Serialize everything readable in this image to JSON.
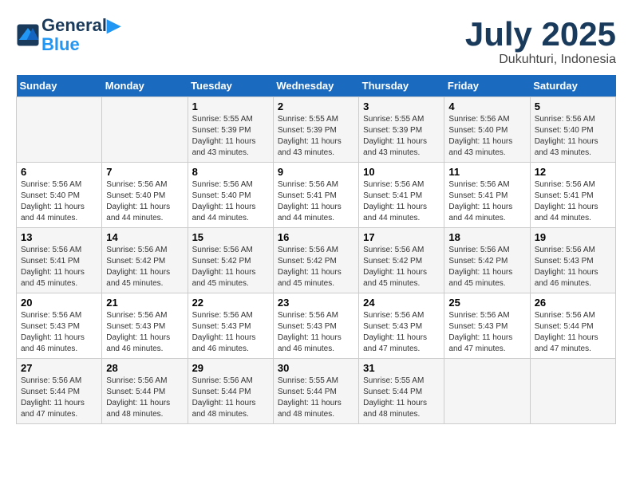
{
  "logo": {
    "line1": "General",
    "line2": "Blue"
  },
  "title": "July 2025",
  "subtitle": "Dukuhturi, Indonesia",
  "days_header": [
    "Sunday",
    "Monday",
    "Tuesday",
    "Wednesday",
    "Thursday",
    "Friday",
    "Saturday"
  ],
  "weeks": [
    [
      {
        "day": "",
        "info": ""
      },
      {
        "day": "",
        "info": ""
      },
      {
        "day": "1",
        "info": "Sunrise: 5:55 AM\nSunset: 5:39 PM\nDaylight: 11 hours and 43 minutes."
      },
      {
        "day": "2",
        "info": "Sunrise: 5:55 AM\nSunset: 5:39 PM\nDaylight: 11 hours and 43 minutes."
      },
      {
        "day": "3",
        "info": "Sunrise: 5:55 AM\nSunset: 5:39 PM\nDaylight: 11 hours and 43 minutes."
      },
      {
        "day": "4",
        "info": "Sunrise: 5:56 AM\nSunset: 5:40 PM\nDaylight: 11 hours and 43 minutes."
      },
      {
        "day": "5",
        "info": "Sunrise: 5:56 AM\nSunset: 5:40 PM\nDaylight: 11 hours and 43 minutes."
      }
    ],
    [
      {
        "day": "6",
        "info": "Sunrise: 5:56 AM\nSunset: 5:40 PM\nDaylight: 11 hours and 44 minutes."
      },
      {
        "day": "7",
        "info": "Sunrise: 5:56 AM\nSunset: 5:40 PM\nDaylight: 11 hours and 44 minutes."
      },
      {
        "day": "8",
        "info": "Sunrise: 5:56 AM\nSunset: 5:40 PM\nDaylight: 11 hours and 44 minutes."
      },
      {
        "day": "9",
        "info": "Sunrise: 5:56 AM\nSunset: 5:41 PM\nDaylight: 11 hours and 44 minutes."
      },
      {
        "day": "10",
        "info": "Sunrise: 5:56 AM\nSunset: 5:41 PM\nDaylight: 11 hours and 44 minutes."
      },
      {
        "day": "11",
        "info": "Sunrise: 5:56 AM\nSunset: 5:41 PM\nDaylight: 11 hours and 44 minutes."
      },
      {
        "day": "12",
        "info": "Sunrise: 5:56 AM\nSunset: 5:41 PM\nDaylight: 11 hours and 44 minutes."
      }
    ],
    [
      {
        "day": "13",
        "info": "Sunrise: 5:56 AM\nSunset: 5:41 PM\nDaylight: 11 hours and 45 minutes."
      },
      {
        "day": "14",
        "info": "Sunrise: 5:56 AM\nSunset: 5:42 PM\nDaylight: 11 hours and 45 minutes."
      },
      {
        "day": "15",
        "info": "Sunrise: 5:56 AM\nSunset: 5:42 PM\nDaylight: 11 hours and 45 minutes."
      },
      {
        "day": "16",
        "info": "Sunrise: 5:56 AM\nSunset: 5:42 PM\nDaylight: 11 hours and 45 minutes."
      },
      {
        "day": "17",
        "info": "Sunrise: 5:56 AM\nSunset: 5:42 PM\nDaylight: 11 hours and 45 minutes."
      },
      {
        "day": "18",
        "info": "Sunrise: 5:56 AM\nSunset: 5:42 PM\nDaylight: 11 hours and 45 minutes."
      },
      {
        "day": "19",
        "info": "Sunrise: 5:56 AM\nSunset: 5:43 PM\nDaylight: 11 hours and 46 minutes."
      }
    ],
    [
      {
        "day": "20",
        "info": "Sunrise: 5:56 AM\nSunset: 5:43 PM\nDaylight: 11 hours and 46 minutes."
      },
      {
        "day": "21",
        "info": "Sunrise: 5:56 AM\nSunset: 5:43 PM\nDaylight: 11 hours and 46 minutes."
      },
      {
        "day": "22",
        "info": "Sunrise: 5:56 AM\nSunset: 5:43 PM\nDaylight: 11 hours and 46 minutes."
      },
      {
        "day": "23",
        "info": "Sunrise: 5:56 AM\nSunset: 5:43 PM\nDaylight: 11 hours and 46 minutes."
      },
      {
        "day": "24",
        "info": "Sunrise: 5:56 AM\nSunset: 5:43 PM\nDaylight: 11 hours and 47 minutes."
      },
      {
        "day": "25",
        "info": "Sunrise: 5:56 AM\nSunset: 5:43 PM\nDaylight: 11 hours and 47 minutes."
      },
      {
        "day": "26",
        "info": "Sunrise: 5:56 AM\nSunset: 5:44 PM\nDaylight: 11 hours and 47 minutes."
      }
    ],
    [
      {
        "day": "27",
        "info": "Sunrise: 5:56 AM\nSunset: 5:44 PM\nDaylight: 11 hours and 47 minutes."
      },
      {
        "day": "28",
        "info": "Sunrise: 5:56 AM\nSunset: 5:44 PM\nDaylight: 11 hours and 48 minutes."
      },
      {
        "day": "29",
        "info": "Sunrise: 5:56 AM\nSunset: 5:44 PM\nDaylight: 11 hours and 48 minutes."
      },
      {
        "day": "30",
        "info": "Sunrise: 5:55 AM\nSunset: 5:44 PM\nDaylight: 11 hours and 48 minutes."
      },
      {
        "day": "31",
        "info": "Sunrise: 5:55 AM\nSunset: 5:44 PM\nDaylight: 11 hours and 48 minutes."
      },
      {
        "day": "",
        "info": ""
      },
      {
        "day": "",
        "info": ""
      }
    ]
  ]
}
